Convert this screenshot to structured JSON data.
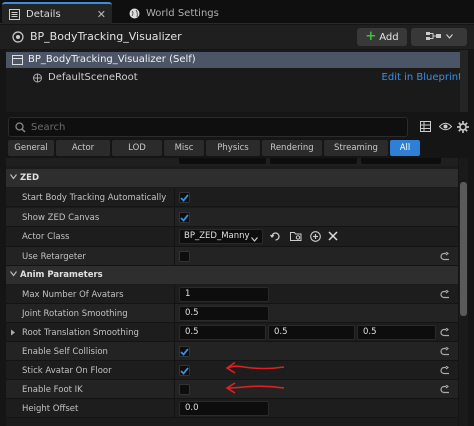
{
  "tabs": [
    {
      "label": "Details",
      "icon": "details-icon",
      "active": true
    },
    {
      "label": "World Settings",
      "icon": "globe-icon",
      "active": false
    }
  ],
  "header": {
    "title": "BP_BodyTracking_Visualizer",
    "add_label": "Add"
  },
  "tree": {
    "root_label": "BP_BodyTracking_Visualizer (Self)",
    "child_label": "DefaultSceneRoot",
    "edit_link": "Edit in Blueprint"
  },
  "search": {
    "placeholder": "Search"
  },
  "categories": [
    "General",
    "Actor",
    "LOD",
    "Misc",
    "Physics",
    "Rendering",
    "Streaming",
    "All"
  ],
  "active_category": "All",
  "sections": {
    "zed": "ZED",
    "anim": "Anim Parameters"
  },
  "properties": {
    "start_tracking": {
      "label": "Start Body Tracking Automatically",
      "checked": true
    },
    "show_canvas": {
      "label": "Show ZED Canvas",
      "checked": true
    },
    "actor_class": {
      "label": "Actor Class",
      "value": "BP_ZED_Manny"
    },
    "use_retargeter": {
      "label": "Use Retargeter",
      "checked": false
    },
    "max_avatars": {
      "label": "Max Number Of Avatars",
      "value": "1"
    },
    "joint_smoothing": {
      "label": "Joint Rotation Smoothing",
      "value": "0.5"
    },
    "root_smoothing": {
      "label": "Root Translation Smoothing",
      "x": "0.5",
      "y": "0.5",
      "z": "0.5"
    },
    "self_collision": {
      "label": "Enable Self Collision",
      "checked": true
    },
    "stick_floor": {
      "label": "Stick Avatar On Floor",
      "checked": true
    },
    "foot_ik": {
      "label": "Enable Foot IK",
      "checked": false
    },
    "height_offset": {
      "label": "Height Offset",
      "value": "0.0"
    }
  },
  "colors": {
    "accent": "#2f7fd6",
    "selection": "#4c5566",
    "link": "#3c8ee6",
    "add_plus": "#43c043",
    "annotation_arrow": "#e02020"
  }
}
